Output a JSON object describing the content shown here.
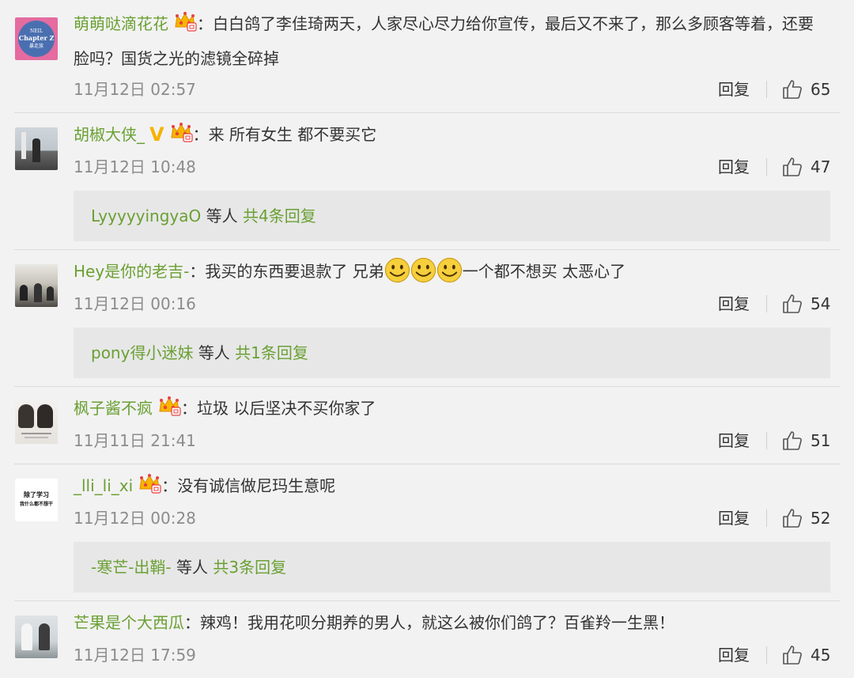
{
  "comments": [
    {
      "user": "萌萌哒滴花花",
      "text": "白白鸽了李佳琦两天，人家尽心尽力给你宣传，最后又不来了，那么多顾客等着，还要脸吗？国货之光的滤镜全碎掉",
      "time": "11月12日 02:57",
      "reply_label": "回复",
      "likes": "65",
      "avatar_text_top": "NEIL",
      "avatar_text_mid": "Chapter Z",
      "avatar_text_bot": "暴走族",
      "badge": "vip-crown-icon"
    },
    {
      "user": "胡椒大侠_",
      "v_mark": "V",
      "text": "来 所有女生 都不要买它",
      "time": "11月12日 10:48",
      "reply_label": "回复",
      "likes": "47",
      "sub_user": "LyyyyyingyaO",
      "sub_mid": "等人",
      "sub_count": "共4条回复"
    },
    {
      "user": "Hey是你的老吉-",
      "text_a": "我买的东西要退款了 兄弟",
      "text_b": "一个都不想买 太恶心了",
      "time": "11月12日 00:16",
      "reply_label": "回复",
      "likes": "54",
      "sub_user": "pony得小迷妹",
      "sub_mid": "等人",
      "sub_count": "共1条回复"
    },
    {
      "user": "枫子酱不疯",
      "text": "垃圾 以后坚决不买你家了",
      "time": "11月11日 21:41",
      "reply_label": "回复",
      "likes": "51"
    },
    {
      "user": "_lli_li_xi",
      "text": "没有诚信做尼玛生意呢",
      "time": "11月12日 00:28",
      "reply_label": "回复",
      "likes": "52",
      "avatar_text_1": "除了学习",
      "avatar_text_2": "我什么都不想干",
      "sub_user": "-寒芒-出鞘-",
      "sub_mid": "等人",
      "sub_count": "共3条回复"
    },
    {
      "user": "芒果是个大西瓜",
      "text": "辣鸡！我用花呗分期养的男人，就这么被你们鸽了？百雀羚一生黑！",
      "time": "11月12日 17:59",
      "reply_label": "回复",
      "likes": "45"
    }
  ],
  "colors": {
    "name": "#6aa033",
    "meta": "#8c8c8c",
    "background": "#f2f2f2",
    "reply_box": "#e7e7e7",
    "v_badge": "#f5b300"
  }
}
